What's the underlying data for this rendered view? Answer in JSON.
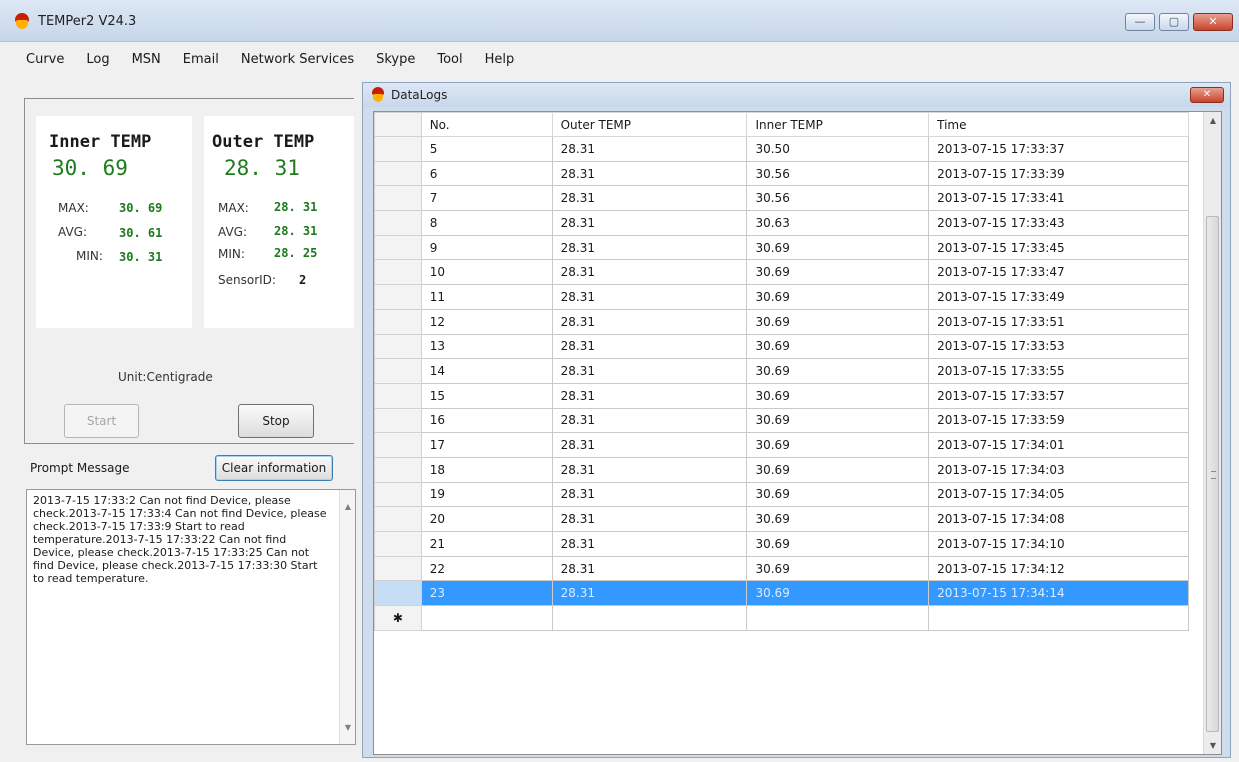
{
  "app": {
    "title": "TEMPer2 V24.3"
  },
  "window_controls": {
    "minimize": "—",
    "maximize": "▢",
    "close": "✕"
  },
  "menu": [
    "Curve",
    "Log",
    "MSN",
    "Email",
    "Network Services",
    "Skype",
    "Tool",
    "Help"
  ],
  "inner": {
    "title": "Inner TEMP",
    "value": "30. 69",
    "max_label": "MAX:",
    "max": "30. 69",
    "avg_label": "AVG:",
    "avg": "30. 61",
    "min_label": "MIN:",
    "min": "30. 31"
  },
  "outer": {
    "title": "Outer TEMP",
    "value": "28. 31",
    "max_label": "MAX:",
    "max": "28. 31",
    "avg_label": "AVG:",
    "avg": "28. 31",
    "min_label": "MIN:",
    "min": "28. 25",
    "sensor_label": "SensorID:",
    "sensor_id": "2"
  },
  "unit": "Unit:Centigrade",
  "buttons": {
    "start": "Start",
    "stop": "Stop",
    "clear": "Clear information"
  },
  "prompt": {
    "label": "Prompt Message",
    "text": "2013-7-15 17:33:2 Can not find Device, please check.2013-7-15 17:33:4 Can not find Device, please check.2013-7-15 17:33:9 Start to read temperature.2013-7-15 17:33:22 Can not find Device, please check.2013-7-15 17:33:25 Can not find Device, please check.2013-7-15 17:33:30 Start to read temperature."
  },
  "datalogs": {
    "title": "DataLogs",
    "close": "✕",
    "new_row_marker": "✱",
    "columns": [
      "No.",
      "Outer TEMP",
      "Inner TEMP",
      "Time"
    ],
    "selected_no": "23",
    "rows": [
      [
        "5",
        "28.31",
        "30.50",
        "2013-07-15 17:33:37"
      ],
      [
        "6",
        "28.31",
        "30.56",
        "2013-07-15 17:33:39"
      ],
      [
        "7",
        "28.31",
        "30.56",
        "2013-07-15 17:33:41"
      ],
      [
        "8",
        "28.31",
        "30.63",
        "2013-07-15 17:33:43"
      ],
      [
        "9",
        "28.31",
        "30.69",
        "2013-07-15 17:33:45"
      ],
      [
        "10",
        "28.31",
        "30.69",
        "2013-07-15 17:33:47"
      ],
      [
        "11",
        "28.31",
        "30.69",
        "2013-07-15 17:33:49"
      ],
      [
        "12",
        "28.31",
        "30.69",
        "2013-07-15 17:33:51"
      ],
      [
        "13",
        "28.31",
        "30.69",
        "2013-07-15 17:33:53"
      ],
      [
        "14",
        "28.31",
        "30.69",
        "2013-07-15 17:33:55"
      ],
      [
        "15",
        "28.31",
        "30.69",
        "2013-07-15 17:33:57"
      ],
      [
        "16",
        "28.31",
        "30.69",
        "2013-07-15 17:33:59"
      ],
      [
        "17",
        "28.31",
        "30.69",
        "2013-07-15 17:34:01"
      ],
      [
        "18",
        "28.31",
        "30.69",
        "2013-07-15 17:34:03"
      ],
      [
        "19",
        "28.31",
        "30.69",
        "2013-07-15 17:34:05"
      ],
      [
        "20",
        "28.31",
        "30.69",
        "2013-07-15 17:34:08"
      ],
      [
        "21",
        "28.31",
        "30.69",
        "2013-07-15 17:34:10"
      ],
      [
        "22",
        "28.31",
        "30.69",
        "2013-07-15 17:34:12"
      ],
      [
        "23",
        "28.31",
        "30.69",
        "2013-07-15 17:34:14"
      ]
    ]
  },
  "colors": {
    "value_green": "#1e7a1e",
    "selection": "#3399ff",
    "close_red": "#c9442c"
  }
}
